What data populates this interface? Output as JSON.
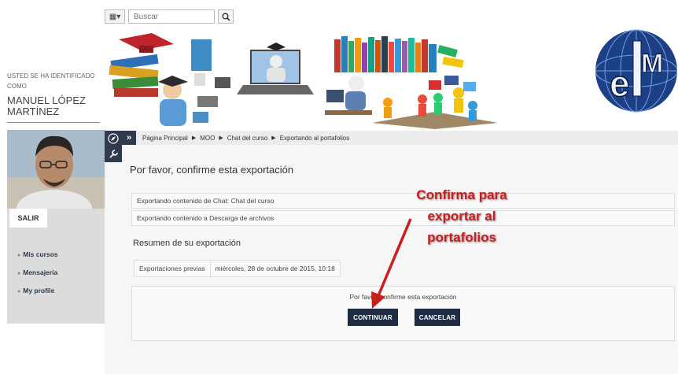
{
  "topbar": {
    "menu_icon": "user-menu-icon",
    "search_placeholder": "Buscar",
    "search_icon": "magnifier-icon"
  },
  "sidebar": {
    "identified_label": "USTED SE HA IDENTIFICADO COMO",
    "user_name": "MANUEL LÓPEZ MARTÍNEZ",
    "logout_label": "SALIR",
    "menu_items": [
      "Mis cursos",
      "Mensajería",
      "My profile"
    ]
  },
  "breadcrumb": {
    "toggle_label": "»",
    "items": [
      "Página Principal",
      "MOO",
      "Chat del curso",
      "Exportando al portafolios"
    ]
  },
  "main": {
    "heading": "Por favor, confirme esta exportación",
    "export_rows": [
      "Exportando contenido de Chat: Chat del curso",
      "Exportando contenido a Descarga de archivos"
    ],
    "summary_title": "Resumen de su exportación",
    "summary_key": "Exportaciones previas",
    "summary_value": "miércoles, 28 de octubre de 2015, 10:18",
    "confirm_text": "Por favor, confirme esta exportación",
    "continue_label": "CONTINUAR",
    "cancel_label": "CANCELAR"
  },
  "annotation": {
    "lines": [
      "Confirma para",
      "exportar al",
      "portafolios"
    ],
    "color": "#c81e1e"
  },
  "logo": {
    "text": "eLM"
  }
}
